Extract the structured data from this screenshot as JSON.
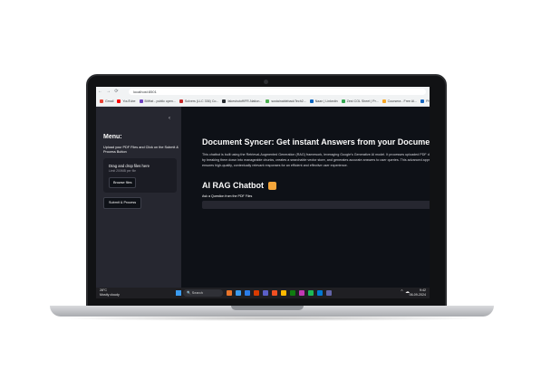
{
  "browser": {
    "url": "localhost:8501",
    "nav": [
      "←",
      "→",
      "⟳"
    ],
    "bookmarks": [
      {
        "label": "Gmail",
        "color": "#ea4335"
      },
      {
        "label": "YouTube",
        "color": "#ff0000"
      },
      {
        "label": "BitHat - public open...",
        "color": "#6f42c1"
      },
      {
        "label": "Solvers (LLC 336) Co...",
        "color": "#c62828"
      },
      {
        "label": "fakeshutoff/FR-Nation...",
        "color": "#24292e"
      },
      {
        "label": "sustainablebackTech2...",
        "color": "#4caf50"
      },
      {
        "label": "Naan | Linkedin",
        "color": "#0a66c2"
      },
      {
        "label": "Zest COL Sheet | Pr...",
        "color": "#34a853"
      },
      {
        "label": "Coursera - Free AI...",
        "color": "#f9a825"
      },
      {
        "label": "Photocode in",
        "color": "#1565c0"
      }
    ]
  },
  "sidebar": {
    "collapse_icon": "‹",
    "menu_title": "Menu:",
    "upload_label": "Upload your PDF Files and Click on the Submit & Process Button",
    "dropzone_title": "Drag and drop files here",
    "dropzone_limit": "Limit 200MB per file",
    "browse_label": "Browse files",
    "submit_label": "Submit & Process"
  },
  "main": {
    "title": "Document Syncer: Get instant Answers from your Documents",
    "description": "This chatbot is built using the Retrieval-Augmented Generation (RAG) framework, leveraging Google's Generative AI model. It processes uploaded PDF documents by breaking them down into manageable chunks, creates a searchable vector store, and generates accurate answers to user queries. This advanced approach ensures high-quality, contextually relevant responses for an efficient and effective user experience.",
    "chat_title": "AI RAG Chatbot",
    "question_label": "Ask a Question from the PDF Files",
    "question_value": ""
  },
  "taskbar": {
    "weather_temp": "28°C",
    "weather_desc": "Mostly cloudy",
    "search_label": "Search",
    "search_icon": "🔍",
    "tray_icons": "⌃ ☁",
    "time": "9:42",
    "date": "06-09-2024",
    "apps": [
      "#e8742a",
      "#3a9bf0",
      "#2b7de9",
      "#d83b01",
      "#5b5fc7",
      "#f25022",
      "#ffb900",
      "#107c10",
      "#c239b3",
      "#1db954",
      "#0078d4",
      "#6264a7"
    ]
  }
}
